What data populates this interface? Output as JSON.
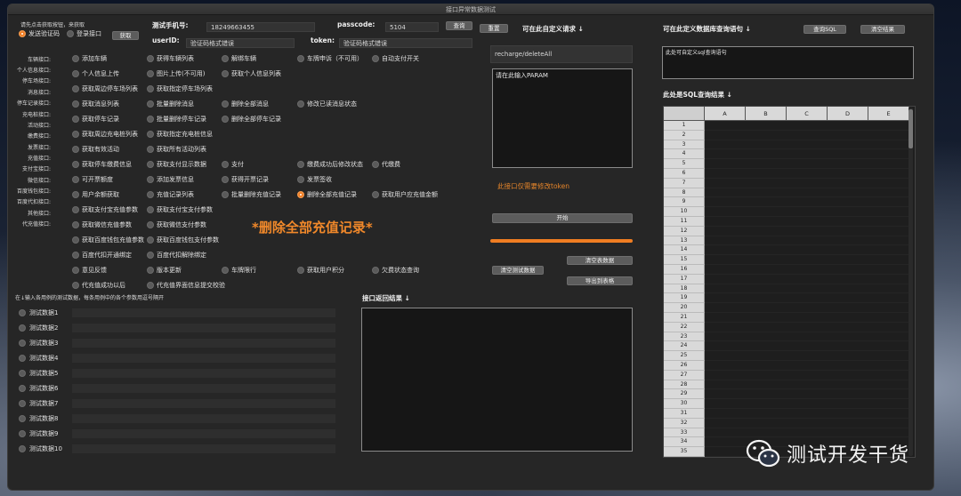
{
  "window": {
    "title": "接口异常数据测试"
  },
  "login": {
    "hint": "请先点击获取按钮，来获取",
    "send_code_label": "发送验证码",
    "login_api_label": "登录接口",
    "get_button": "获取"
  },
  "header": {
    "phone_label": "测试手机号:",
    "phone_value": "18249663455",
    "passcode_label": "passcode:",
    "passcode_value": "5104",
    "query_button": "查询",
    "reset_button": "重置",
    "userid_label": "userID:",
    "userid_value": "验证码格式错误",
    "token_label": "token:",
    "token_value": "验证码格式错误"
  },
  "categories": [
    "车辆接口:",
    "个人信息接口:",
    "停车场接口:",
    "消息接口:",
    "停车记录接口:",
    "充电桩接口:",
    "活动接口:",
    "缴费接口:",
    "发票接口:",
    "充值接口:",
    "支付宝接口:",
    "微信接口:",
    "百度钱包接口:",
    "百度代扣接口:",
    "其他接口:",
    "代充值接口:"
  ],
  "options": {
    "r0": [
      "添加车辆",
      "获得车辆列表",
      "解绑车辆",
      "车牌申诉（不可用）",
      "自动支付开关"
    ],
    "r1": [
      "个人信息上传",
      "图片上传(不可用)",
      "获取个人信息列表"
    ],
    "r2": [
      "获取周边停车场列表",
      "获取指定停车场列表"
    ],
    "r3": [
      "获取消息列表",
      "批量删除消息",
      "删除全部消息",
      "修改已读消息状态"
    ],
    "r4": [
      "获取停车记录",
      "批量删除停车记录",
      "删除全部停车记录"
    ],
    "r5": [
      "获取周边充电桩列表",
      "获取指定充电桩信息"
    ],
    "r6": [
      "获取有效活动",
      "获取所有活动列表"
    ],
    "r7": [
      "获取停车缴费信息",
      "获取支付显示数据",
      "支付",
      "缴费成功后修改状态",
      "代缴费"
    ],
    "r8": [
      "可开票额度",
      "添加发票信息",
      "获得开票记录",
      "发票签收"
    ],
    "r9": [
      "用户余额获取",
      "充值记录列表",
      "批量删除充值记录",
      "删除全部充值记录",
      "获取用户应充值金额"
    ],
    "r10": [
      "获取支付宝充值参数",
      "获取支付宝支付参数"
    ],
    "r11": [
      "获取微信充值参数",
      "获取微信支付参数"
    ],
    "r12": [
      "获取百度钱包充值参数",
      "获取百度钱包支付参数"
    ],
    "r13": [
      "百度代扣开通绑定",
      "百度代扣解除绑定"
    ],
    "r14": [
      "意见反馈",
      "版本更新",
      "车牌限行",
      "获取用户积分",
      "欠费状态查询"
    ],
    "r15": [
      "代充值成功以后",
      "代充值界面信息提交校验"
    ]
  },
  "selected_banner": "*删除全部充值记录*",
  "test_data": {
    "hint": "在↓输入各用例的测试数据，每条用例中的各个参数用逗号隔开",
    "rows": [
      "测试数据1",
      "测试数据2",
      "测试数据3",
      "测试数据4",
      "测试数据5",
      "测试数据6",
      "测试数据7",
      "测试数据8",
      "测试数据9",
      "测试数据10"
    ]
  },
  "custom_request": {
    "title": "可在此自定义请求 ↓",
    "path_value": "recharge/deleteAll",
    "param_placeholder": "请在此输入PARAM",
    "note": "此接口仅需要修改token",
    "start_button": "开始",
    "clear_test_button": "清空测试数据",
    "clear_table_button": "清空表数据",
    "export_button": "导出到表格",
    "progress": 1.0
  },
  "response": {
    "title": "接口返回结果 ↓"
  },
  "sql": {
    "title": "可在此定义数据库查询语句 ↓",
    "query_button": "查询SQL",
    "clear_button": "清空结果",
    "placeholder": "此处可自定义sql查询语句",
    "results_title": "此处是SQL查询结果 ↓",
    "columns": [
      "A",
      "B",
      "C",
      "D",
      "E"
    ],
    "row_numbers": [
      "1",
      "2",
      "3",
      "4",
      "5",
      "6",
      "7",
      "8",
      "9",
      "10",
      "11",
      "12",
      "13",
      "14",
      "15",
      "16",
      "17",
      "18",
      "19",
      "20",
      "21",
      "22",
      "23",
      "24",
      "25",
      "26",
      "27",
      "28",
      "29",
      "30",
      "31",
      "32",
      "33",
      "34",
      "35"
    ]
  },
  "watermark": {
    "text": "测试开发干货"
  },
  "colors": {
    "accent": "#f07d22",
    "banner": "#f0882a",
    "note": "#e6852a"
  }
}
